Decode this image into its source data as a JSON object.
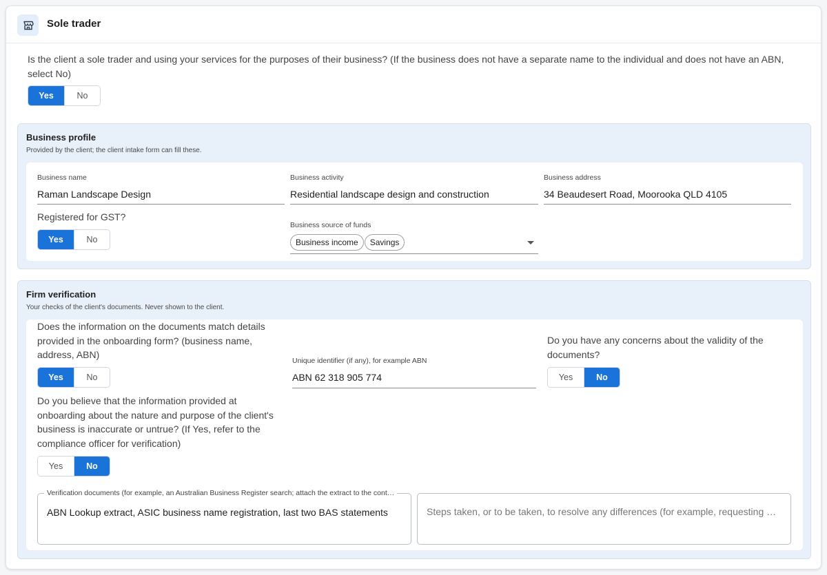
{
  "header": {
    "title": "Sole trader",
    "icon": "storefront-icon"
  },
  "sole_trader_question": {
    "text": "Is the client a sole trader and using your services for the purposes of their business? (If the business does not have a separate name to the individual and does not have an ABN, select No)",
    "yes_label": "Yes",
    "no_label": "No",
    "selected": "Yes"
  },
  "business_profile": {
    "title": "Business profile",
    "subtitle": "Provided by the client; the client intake form can fill these.",
    "business_name": {
      "label": "Business name",
      "value": "Raman Landscape Design"
    },
    "business_activity": {
      "label": "Business activity",
      "value": "Residential landscape design and construction"
    },
    "business_address": {
      "label": "Business address",
      "value": "34 Beaudesert Road, Moorooka QLD 4105"
    },
    "gst": {
      "question": "Registered for GST?",
      "yes_label": "Yes",
      "no_label": "No",
      "selected": "Yes"
    },
    "source_of_funds": {
      "label": "Business source of funds",
      "chips": [
        "Business income",
        "Savings"
      ]
    }
  },
  "firm_verification": {
    "title": "Firm verification",
    "subtitle": "Your checks of the client's documents. Never shown to the client.",
    "documents_match": {
      "question": "Does the information on the documents match details provided in the onboarding form? (business name, address, ABN)",
      "yes_label": "Yes",
      "no_label": "No",
      "selected": "Yes"
    },
    "unique_identifier": {
      "label": "Unique identifier (if any), for example ABN",
      "value": "ABN 62 318 905 774"
    },
    "validity_concerns": {
      "question": "Do you have any concerns about the validity of the documents?",
      "yes_label": "Yes",
      "no_label": "No",
      "selected": "No"
    },
    "inaccurate_info": {
      "question": "Do you believe that the information provided at onboarding about the nature and purpose of the client's business is inaccurate or untrue? (If Yes, refer to the compliance officer for verification)",
      "yes_label": "Yes",
      "no_label": "No",
      "selected": "No"
    },
    "verification_documents": {
      "label": "Verification documents (for example, an Australian Business Register search; attach the extract to the cont…",
      "value": "ABN Lookup extract, ASIC business name registration, last two BAS statements"
    },
    "steps_taken": {
      "placeholder": "Steps taken, or to be taken, to resolve any differences (for example, requesting …"
    }
  },
  "colors": {
    "accent": "#1a73d9",
    "section_bg": "#e8f0fa",
    "header_icon_bg": "#e4eefa"
  }
}
